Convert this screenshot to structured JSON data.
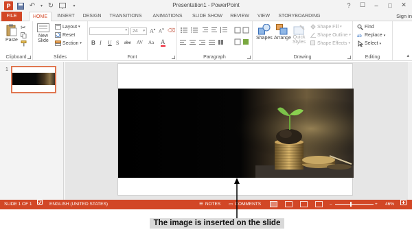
{
  "window": {
    "title": "Presentation1 - PowerPoint",
    "logo_letter": "P",
    "controls": [
      "?",
      "☐",
      "–",
      "□",
      "✕"
    ]
  },
  "tabs": [
    {
      "label": "FILE"
    },
    {
      "label": "HOME"
    },
    {
      "label": "INSERT"
    },
    {
      "label": "DESIGN"
    },
    {
      "label": "TRANSITIONS"
    },
    {
      "label": "ANIMATIONS"
    },
    {
      "label": "SLIDE SHOW"
    },
    {
      "label": "REVIEW"
    },
    {
      "label": "VIEW"
    },
    {
      "label": "STORYBOARDING"
    }
  ],
  "active_tab": "HOME",
  "signin": "Sign in",
  "ribbon": {
    "clipboard": {
      "label": "Clipboard",
      "paste": "Paste"
    },
    "slides": {
      "label": "Slides",
      "new_slide": "New",
      "new_slide_2": "Slide",
      "layout": "Layout",
      "reset": "Reset",
      "section": "Section"
    },
    "font": {
      "label": "Font",
      "font_name": "",
      "font_size": "24",
      "bold": "B",
      "italic": "I",
      "underline": "U",
      "strike": "S",
      "abc": "abc",
      "av": "AV",
      "aa": "Aa"
    },
    "paragraph": {
      "label": "Paragraph"
    },
    "drawing": {
      "label": "Drawing",
      "shapes": "Shapes",
      "arrange": "Arrange",
      "quick_styles": "Quick",
      "quick_styles_2": "Styles",
      "shape_fill": "Shape Fill",
      "shape_outline": "Shape Outline",
      "shape_effects": "Shape Effects"
    },
    "editing": {
      "label": "Editing",
      "find": "Find",
      "replace": "Replace",
      "select": "Select"
    }
  },
  "thumbnails": [
    {
      "number": "1"
    }
  ],
  "statusbar": {
    "slide_info": "SLIDE 1 OF 1",
    "language": "ENGLISH (UNITED STATES)",
    "notes": "NOTES",
    "comments": "COMMENTS",
    "zoom_level": "46%",
    "zoom_minus": "–",
    "zoom_plus": "+"
  },
  "caption": "The image is inserted on the slide",
  "colors": {
    "accent": "#d24726",
    "home_tab_text": "#d24726"
  }
}
